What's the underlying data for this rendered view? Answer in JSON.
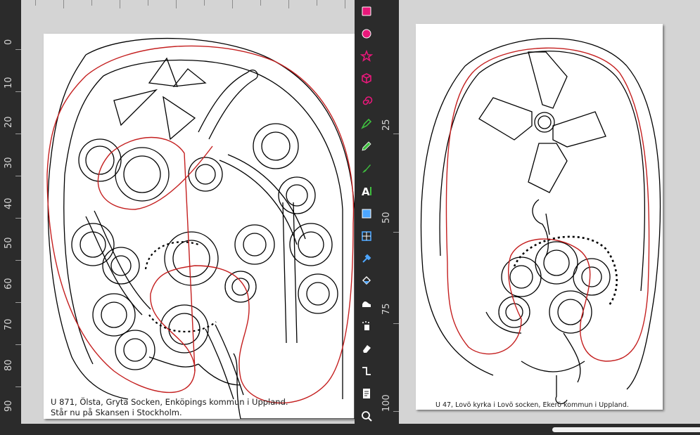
{
  "left_canvas": {
    "ruler_labels": [
      "0",
      "10",
      "20",
      "30",
      "40",
      "50",
      "60",
      "70",
      "80",
      "90"
    ],
    "caption_line1": "U 871, Ölsta, Gryta Socken, Enköpings kommun i Uppland.",
    "caption_line2": "Står nu på Skansen i Stockholm."
  },
  "right_canvas": {
    "ruler_labels": [
      "25",
      "50",
      "75",
      "100"
    ],
    "caption": "U 47, Lovö kyrka i Lovö socken, Ekerö kommun i Uppland."
  },
  "toolbox": {
    "tools": [
      {
        "name": "rectangle-tool",
        "icon": "square-icon",
        "color": "#e8187a"
      },
      {
        "name": "ellipse-tool",
        "icon": "circle-icon",
        "color": "#e8187a"
      },
      {
        "name": "star-tool",
        "icon": "star-icon",
        "color": "#e8187a"
      },
      {
        "name": "3d-box-tool",
        "icon": "cube-icon",
        "color": "#e8187a"
      },
      {
        "name": "spiral-tool",
        "icon": "spiral-icon",
        "color": "#e8187a"
      },
      {
        "name": "bezier-pen-tool",
        "icon": "pen-icon",
        "color": "#3fbf3f"
      },
      {
        "name": "pencil-tool",
        "icon": "pencil-icon",
        "color": "#3fbf3f"
      },
      {
        "name": "calligraphy-tool",
        "icon": "brush-icon",
        "color": "#3fbf3f"
      },
      {
        "name": "text-tool",
        "icon": "text-icon",
        "color": "#ffffff"
      },
      {
        "name": "gradient-tool",
        "icon": "gradient-icon",
        "color": "#4da6ff"
      },
      {
        "name": "mesh-tool",
        "icon": "mesh-icon",
        "color": "#4da6ff"
      },
      {
        "name": "dropper-tool",
        "icon": "dropper-icon",
        "color": "#4da6ff"
      },
      {
        "name": "paint-bucket-tool",
        "icon": "bucket-icon",
        "color": "#4da6ff"
      },
      {
        "name": "tweak-tool",
        "icon": "tweak-icon",
        "color": "#ffffff"
      },
      {
        "name": "spray-tool",
        "icon": "spray-icon",
        "color": "#ffffff"
      },
      {
        "name": "eraser-tool",
        "icon": "eraser-icon",
        "color": "#ffffff"
      },
      {
        "name": "connector-tool",
        "icon": "connector-icon",
        "color": "#ffffff"
      },
      {
        "name": "pages-tool",
        "icon": "pages-icon",
        "color": "#ffffff"
      },
      {
        "name": "zoom-tool",
        "icon": "magnifier-icon",
        "color": "#ffffff"
      }
    ]
  },
  "colors": {
    "stone_outline": "#000000",
    "selection_path": "#c41f1f",
    "toolbar_bg": "#2b2b2b",
    "canvas_bg": "#d4d4d4"
  }
}
